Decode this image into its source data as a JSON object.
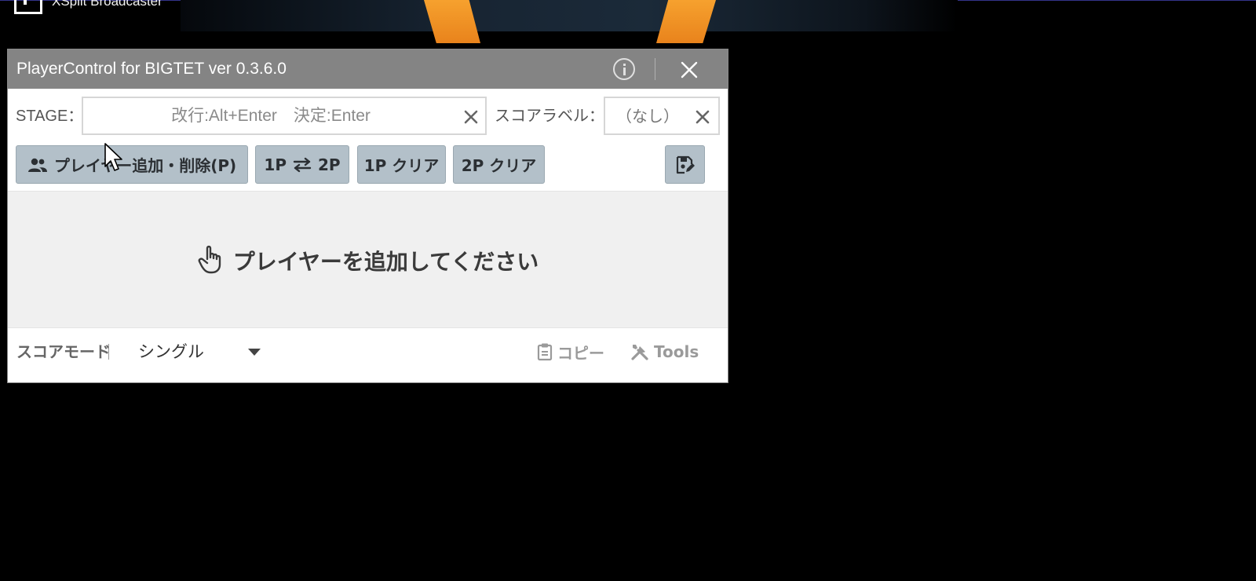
{
  "background": {
    "app_title": "XSplit Broadcaster"
  },
  "window": {
    "title": "PlayerControl for BIGTET ver 0.3.6.0",
    "icons": {
      "info": "info-icon",
      "close": "close-icon"
    }
  },
  "stage": {
    "label": "STAGE：",
    "placeholder": "改行:Alt+Enter　決定:Enter",
    "value": ""
  },
  "score_label": {
    "label": "スコアラベル：",
    "value": "（なし）"
  },
  "toolbar": {
    "add_remove_players": "プレイヤー追加・削除(P)",
    "swap_prefix": "1P",
    "swap_suffix": "2P",
    "clear_1p": "1P クリア",
    "clear_2p": "2P クリア",
    "icons": {
      "players": "people-icon",
      "swap": "swap-arrows-icon",
      "save": "save-edit-icon"
    }
  },
  "empty_state": {
    "message": "プレイヤーを追加してください",
    "icon": "hand-pointer-icon"
  },
  "footer": {
    "score_mode_label": "スコアモード",
    "score_mode_value": "シングル",
    "copy_label": "コピー",
    "tools_label": "Tools",
    "icons": {
      "copy": "clipboard-icon",
      "tools": "tools-icon"
    }
  },
  "colors": {
    "titlebar": "#848484",
    "button": "#b3c0c9",
    "empty_area": "#f0f0f0",
    "accent_orange": "#f6a12e"
  }
}
